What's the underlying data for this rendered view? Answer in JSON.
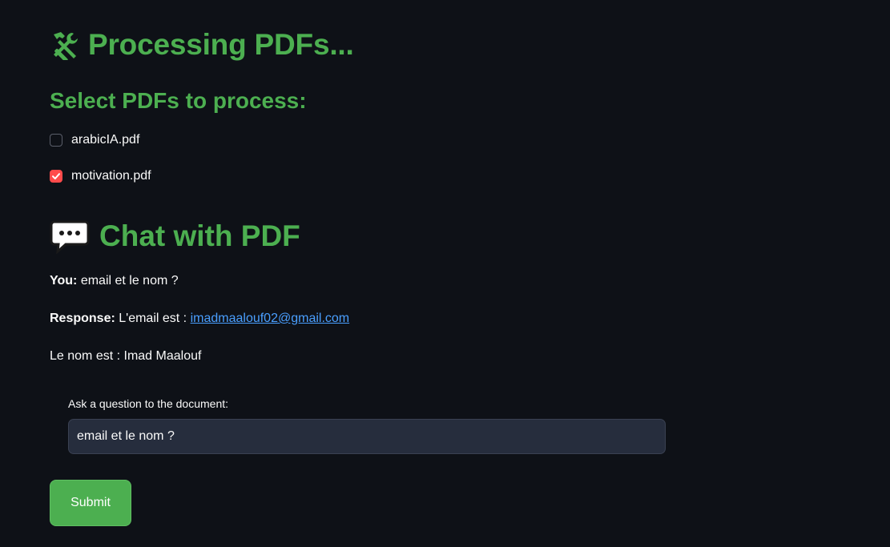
{
  "header": {
    "title": "Processing PDFs...",
    "title_icon": "tools-icon",
    "subtitle": "Select PDFs to process:"
  },
  "pdfs": [
    {
      "label": "arabicIA.pdf",
      "checked": false
    },
    {
      "label": "motivation.pdf",
      "checked": true
    }
  ],
  "chat": {
    "title": "Chat with PDF",
    "title_icon": "speech-bubble-icon",
    "you_label": "You:",
    "you_text": "email et le nom ?",
    "response_label": "Response:",
    "response_text": "L'email est :",
    "response_email": "imadmaalouf02@gmail.com",
    "response_line2": "Le nom est : Imad Maalouf"
  },
  "question": {
    "label": "Ask a question to the document:",
    "value": "email et le nom ?"
  },
  "submit_label": "Submit",
  "colors": {
    "accent": "#4caf50",
    "checkbox": "#ff4b4b",
    "link": "#4a9fff",
    "background": "#0e1117"
  }
}
